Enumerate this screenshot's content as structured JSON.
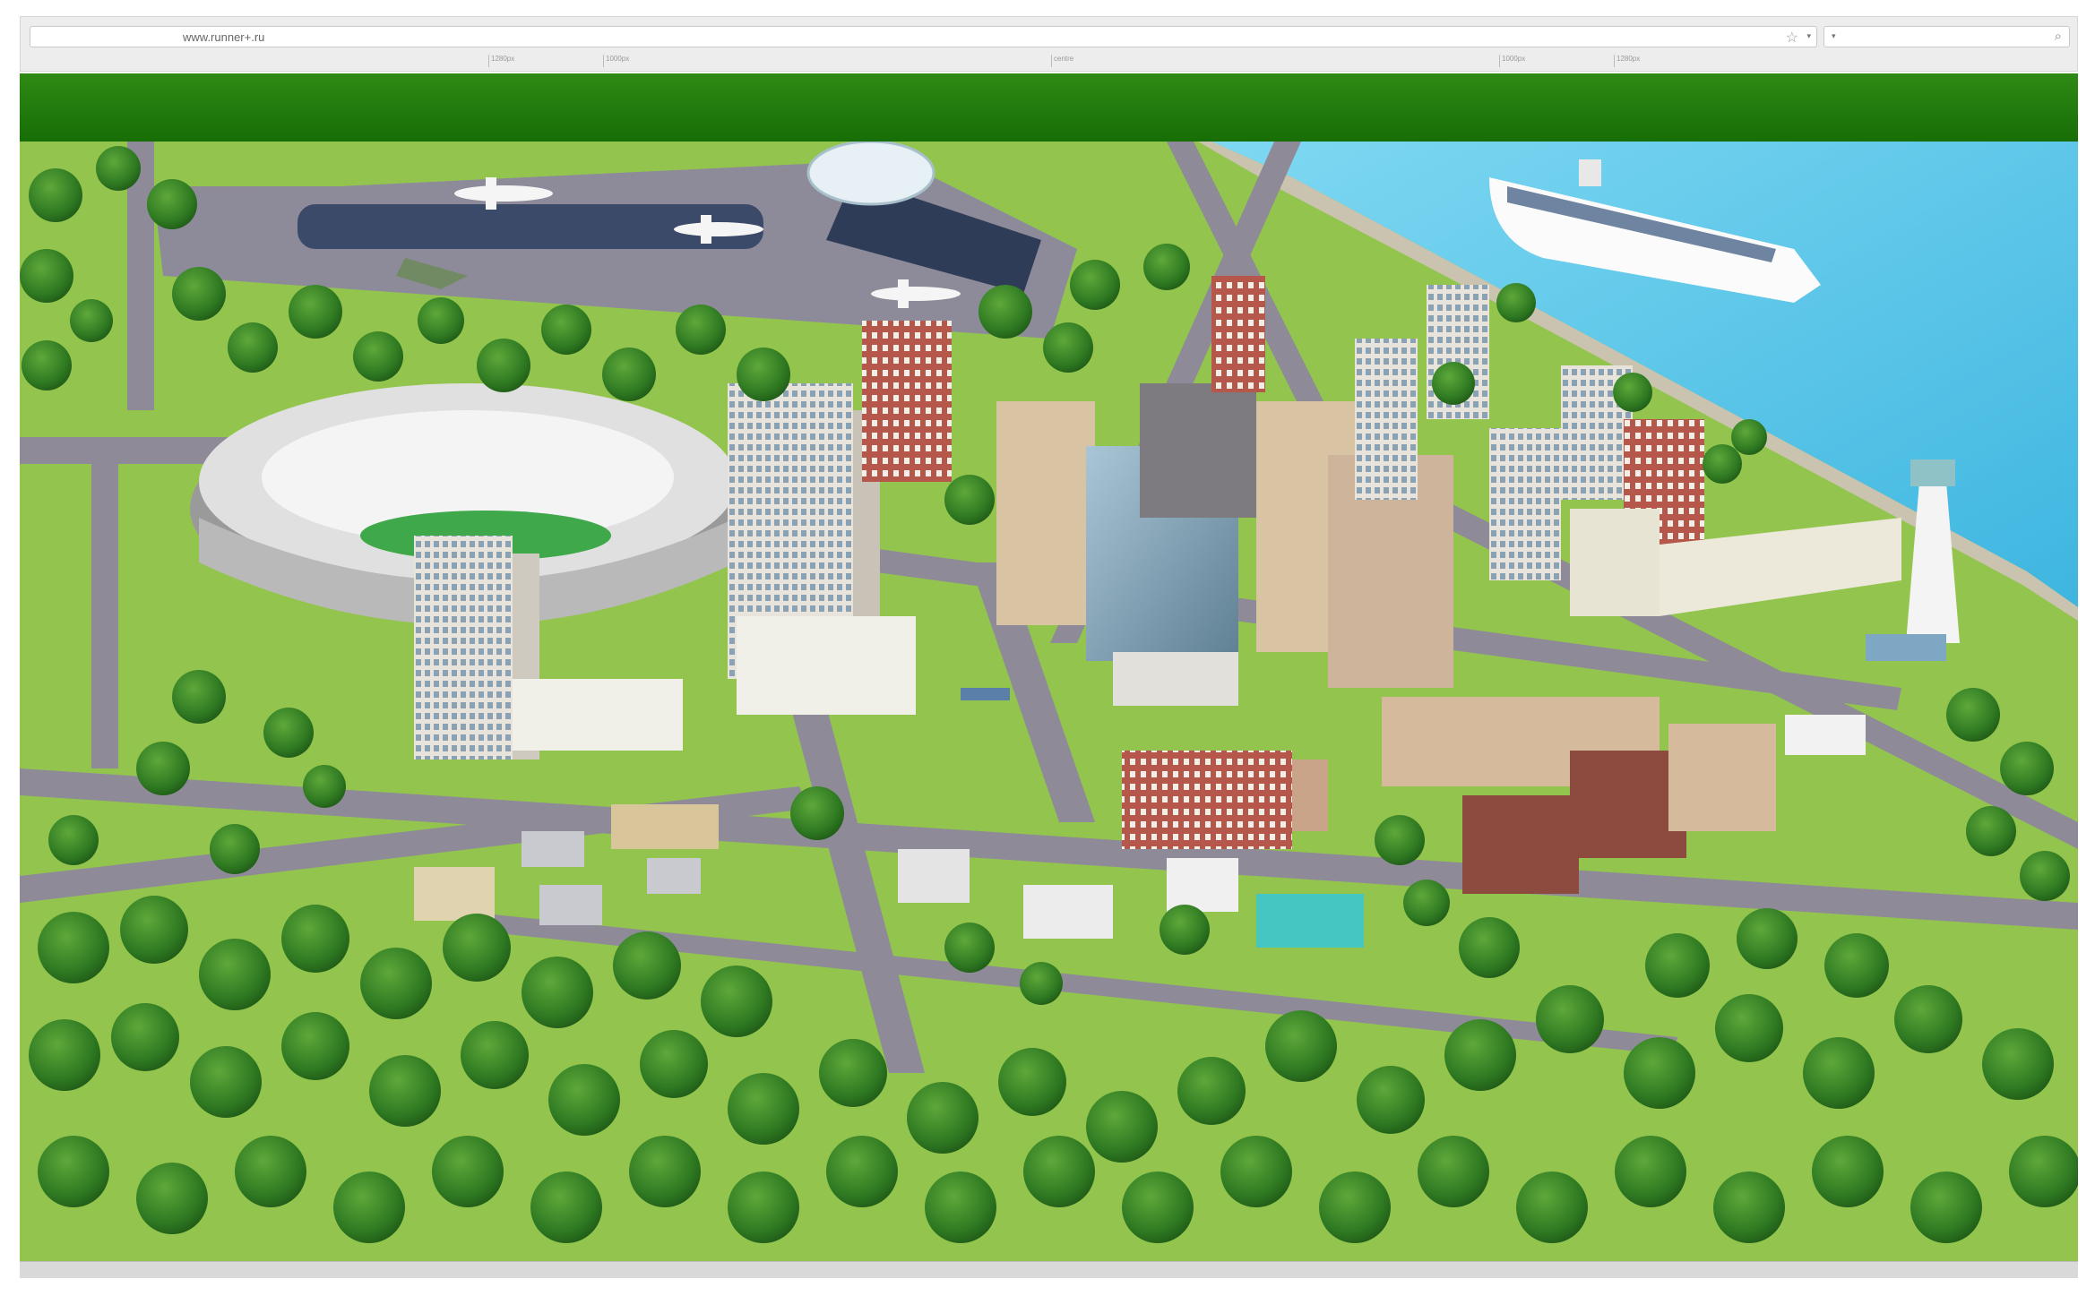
{
  "browser": {
    "url": "www.runner+.ru",
    "url_dropdown_icon": "dropdown-arrow-icon",
    "bookmark_icon": "star-icon",
    "search": {
      "value": "",
      "dropdown_icon": "dropdown-arrow-icon",
      "icon": "search-icon"
    },
    "ruler_labels": [
      "1280px",
      "1000px",
      "centre",
      "1000px",
      "1280px"
    ]
  },
  "header": {
    "color": "#1f7a0c"
  },
  "scene": {
    "description_icons": [
      "airport",
      "stadium",
      "office-towers",
      "cruise-ship",
      "lighthouse",
      "residential-blocks",
      "school",
      "park-trees"
    ],
    "water_color": "#5cc8e8",
    "grass_color": "#8fc24a",
    "road_color": "#8c8996"
  }
}
